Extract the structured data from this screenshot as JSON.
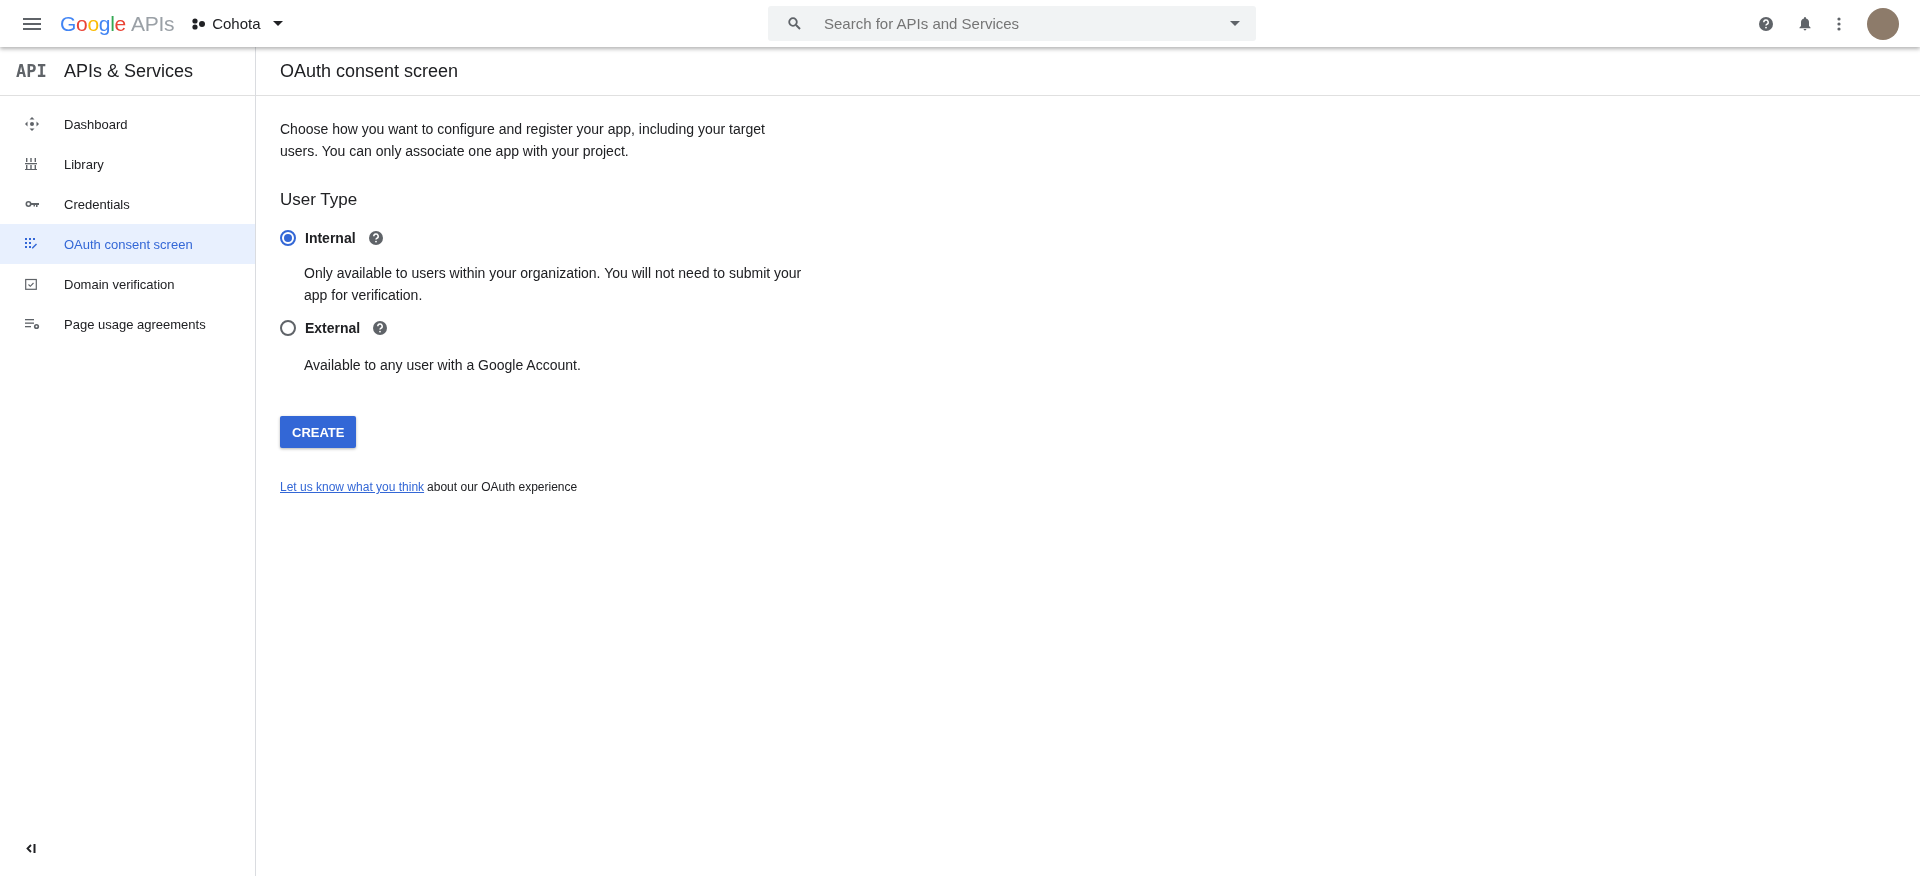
{
  "topbar": {
    "logo": {
      "brand": "Google",
      "product": "APIs"
    },
    "project": "Cohota",
    "search": {
      "placeholder": "Search for APIs and Services"
    }
  },
  "sidebar": {
    "badge": "API",
    "title": "APIs & Services",
    "items": [
      {
        "label": "Dashboard",
        "selected": false
      },
      {
        "label": "Library",
        "selected": false
      },
      {
        "label": "Credentials",
        "selected": false
      },
      {
        "label": "OAuth consent screen",
        "selected": true
      },
      {
        "label": "Domain verification",
        "selected": false
      },
      {
        "label": "Page usage agreements",
        "selected": false
      }
    ]
  },
  "page": {
    "title": "OAuth consent screen",
    "intro": "Choose how you want to configure and register your app, including your target users. You can only associate one app with your project.",
    "section_title": "User Type",
    "options": [
      {
        "label": "Internal",
        "selected": true,
        "description": "Only available to users within your organization. You will not need to submit your app for verification."
      },
      {
        "label": "External",
        "selected": false,
        "description": "Available to any user with a Google Account."
      }
    ],
    "button": "CREATE",
    "feedback": {
      "link": "Let us know what you think",
      "text": "about our OAuth experience"
    }
  }
}
